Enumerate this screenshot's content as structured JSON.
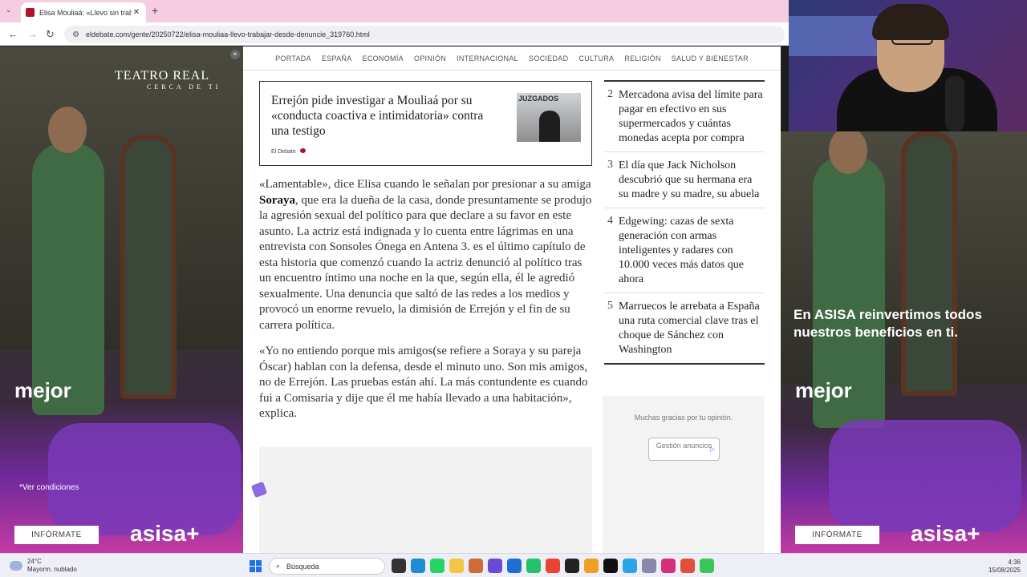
{
  "browser": {
    "tab_title": "Elisa Mouliaá: «Llevo sin trabajar",
    "tab_close": "✕",
    "new_tab": "+",
    "url": "eldebate.com/gente/20250722/elisa-mouliaa-llevo-trabajar-desde-denuncie_319760.html"
  },
  "nav": [
    "PORTADA",
    "ESPAÑA",
    "ECONOMÍA",
    "OPINIÓN",
    "INTERNACIONAL",
    "SOCIEDAD",
    "CULTURA",
    "RELIGIÓN",
    "SALUD Y BIENESTAR"
  ],
  "related": {
    "title": "Errejón pide investigar a Mouliaá por su «conducta coactiva e intimidatoria» contra una testigo",
    "source": "El Debate",
    "thumb_label": "JUZGADOS"
  },
  "article": {
    "p1_a": "«Lamentable», dice Elisa cuando le señalan por presionar a su amiga ",
    "p1_bold": "Soraya",
    "p1_b": ", que era la dueña de la casa, donde presuntamente se produjo la agresión sexual del político para que declare a su favor en este asunto. La actriz está indignada y lo cuenta entre lágrimas en una entrevista con Sonsoles Ónega en Antena 3. es el último capítulo de esta historia que comenzó cuando la actriz denunció al político tras un encuentro íntimo una noche en la que, según ella, él le agredió sexualmente. Una denuncia que saltó de las redes a los medios y provocó un enorme revuelo, la dimisión de Errejón y el fin de su carrera política.",
    "p2": "«Yo no entiendo porque mis amigos(se refiere a Soraya y su pareja Óscar) hablan con la defensa, desde el minuto uno. Son mis amigos, no de Errejón. Las pruebas están ahí. La más contundente es cuando fui a Comisaria y dije que él me había llevado a una habitación», explica."
  },
  "most_read": [
    {
      "num": "2",
      "text": "Mercadona avisa del límite para pagar en efectivo en sus supermercados y cuántas monedas acepta por compra"
    },
    {
      "num": "3",
      "text": "El día que Jack Nicholson descubrió que su hermana era su madre y su madre, su abuela"
    },
    {
      "num": "4",
      "text": "Edgewing: cazas de sexta generación con armas inteligentes y radares con 10.000 veces más datos que ahora"
    },
    {
      "num": "5",
      "text": "Marruecos le arrebata a España una ruta comercial clave tras el choque de Sánchez con Washington"
    }
  ],
  "feedback": {
    "text": "Muchas gracias por tu opinión.",
    "button": "Gestión anuncios"
  },
  "ad_left": {
    "brand_top": "TEATRO REAL",
    "brand_sub": "CERCA DE TI",
    "mejor": "mejor",
    "conditions": "*Ver condiciones",
    "cta": "INFÓRMATE",
    "brand": "asisa+"
  },
  "ad_right": {
    "headline": "En ASISA reinvertimos todos nuestros beneficios en ti.",
    "mejor": "mejor",
    "cta": "INFÓRMATE",
    "brand": "asisa+"
  },
  "taskbar": {
    "temp": "24°C",
    "weather": "Mayorm. nublado",
    "search": "Búsqueda",
    "time": "4:36",
    "date": "15/08/2025"
  },
  "colors": {
    "brand_red": "#b1122a",
    "ad_purple": "#7a3ab8",
    "tab_bar": "#f5cde3"
  }
}
